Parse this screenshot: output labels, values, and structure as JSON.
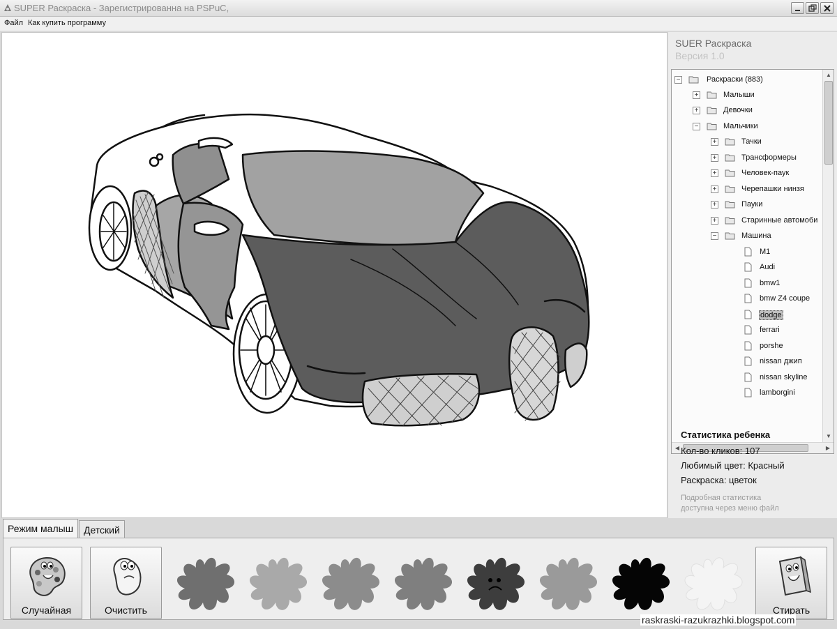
{
  "window": {
    "title": "SUPER Раскраска - Зарегистрированна на PSPuC,",
    "controls": [
      "minimize-icon",
      "maximize-icon",
      "close-icon"
    ]
  },
  "menu": {
    "items": [
      "Файл",
      "Как купить программу"
    ]
  },
  "sidebar": {
    "app_name": "SUER Раскраска",
    "version": "Версия 1.0",
    "tree": [
      {
        "label": "Раскраски (883)",
        "level": 0,
        "state": "expanded",
        "kind": "folder"
      },
      {
        "label": "Малыши",
        "level": 1,
        "state": "collapsed",
        "kind": "folder"
      },
      {
        "label": "Девочки",
        "level": 1,
        "state": "collapsed",
        "kind": "folder"
      },
      {
        "label": "Мальчики",
        "level": 1,
        "state": "expanded",
        "kind": "folder"
      },
      {
        "label": "Тачки",
        "level": 2,
        "state": "collapsed",
        "kind": "folder"
      },
      {
        "label": "Трансформеры",
        "level": 2,
        "state": "collapsed",
        "kind": "folder"
      },
      {
        "label": "Человек-паук",
        "level": 2,
        "state": "collapsed",
        "kind": "folder"
      },
      {
        "label": "Черепашки нинзя",
        "level": 2,
        "state": "collapsed",
        "kind": "folder"
      },
      {
        "label": "Пауки",
        "level": 2,
        "state": "collapsed",
        "kind": "folder"
      },
      {
        "label": "Старинные автомоби",
        "level": 2,
        "state": "collapsed",
        "kind": "folder"
      },
      {
        "label": "Машина",
        "level": 2,
        "state": "expanded",
        "kind": "folder"
      },
      {
        "label": "M1",
        "level": 3,
        "kind": "file"
      },
      {
        "label": "Audi",
        "level": 3,
        "kind": "file"
      },
      {
        "label": "bmw1",
        "level": 3,
        "kind": "file"
      },
      {
        "label": "bmw Z4 coupe",
        "level": 3,
        "kind": "file"
      },
      {
        "label": "dodge",
        "level": 3,
        "kind": "file",
        "selected": true
      },
      {
        "label": "ferrari",
        "level": 3,
        "kind": "file"
      },
      {
        "label": "porshe",
        "level": 3,
        "kind": "file"
      },
      {
        "label": "nissan джип",
        "level": 3,
        "kind": "file"
      },
      {
        "label": "nissan skyline",
        "level": 3,
        "kind": "file"
      },
      {
        "label": "lamborgini",
        "level": 3,
        "kind": "file"
      }
    ]
  },
  "stats": {
    "title": "Статистика ребенка",
    "clicks": "Кол-во кликов: 107",
    "favorite_color": "Любимый цвет: Красный",
    "coloring": "Раскраска: цветок",
    "note_line1": "Подробная статистика",
    "note_line2": "доступна через меню файл"
  },
  "tabs": [
    {
      "label": "Режим малыш",
      "active": true
    },
    {
      "label": "Детский",
      "active": false
    }
  ],
  "toolbar": {
    "random_label": "Случайная",
    "clear_label": "Очистить",
    "erase_label": "Стирать",
    "paint_colors": [
      "#6f6f6f",
      "#a9a9a9",
      "#8c8c8c",
      "#7f7f7f",
      "#3d3d3d",
      "#9a9a9a",
      "#050505",
      "#f4f4f4"
    ]
  },
  "canvas": {
    "picture": "sports-car-coloring"
  },
  "watermark": "raskraski-razukrazhki.blogspot.com"
}
